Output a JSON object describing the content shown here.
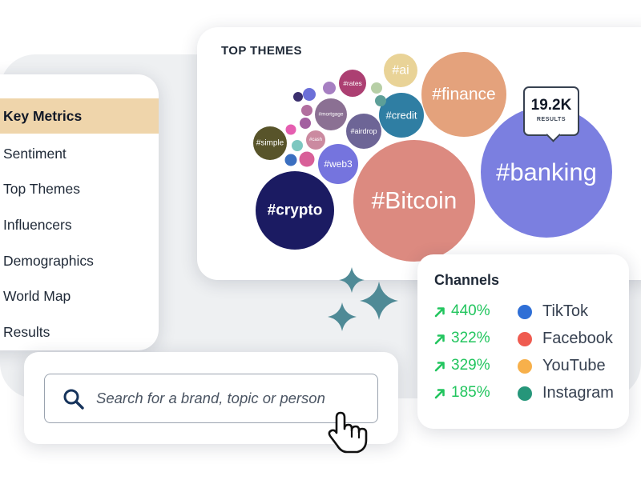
{
  "sidebar": {
    "items": [
      {
        "label": "Key Metrics",
        "active": true
      },
      {
        "label": "Sentiment",
        "active": false
      },
      {
        "label": "Top Themes",
        "active": false
      },
      {
        "label": "Influencers",
        "active": false
      },
      {
        "label": "Demographics",
        "active": false
      },
      {
        "label": "World Map",
        "active": false
      },
      {
        "label": "Results",
        "active": false
      }
    ]
  },
  "themes": {
    "title": "TOP THEMES",
    "bubbles": [
      {
        "label": "#banking",
        "color": "#7b7fe0"
      },
      {
        "label": "#Bitcoin",
        "color": "#dc8a80"
      },
      {
        "label": "#crypto",
        "color": "#1b1b62"
      },
      {
        "label": "#finance",
        "color": "#e4a27c"
      },
      {
        "label": "#credit",
        "color": "#2f7ea3"
      },
      {
        "label": "#ai",
        "color": "#e9d397"
      },
      {
        "label": "#web3",
        "color": "#7574de"
      },
      {
        "label": "#airdrop",
        "color": "#6d6596"
      },
      {
        "label": "#rates",
        "color": "#ac3f72"
      },
      {
        "label": "#mortgage",
        "color": "#8b7093"
      },
      {
        "label": "#simple",
        "color": "#58542a"
      },
      {
        "label": "#cash",
        "color": "#cb8aa0"
      },
      {
        "label": "",
        "color": "#6b6fd8"
      },
      {
        "label": "",
        "color": "#a67fc2"
      },
      {
        "label": "",
        "color": "#b26f9f"
      },
      {
        "label": "",
        "color": "#3b2f6e"
      },
      {
        "label": "",
        "color": "#a35fa0"
      },
      {
        "label": "",
        "color": "#e55db0"
      },
      {
        "label": "",
        "color": "#7dc7c0"
      },
      {
        "label": "",
        "color": "#3b6fc0"
      },
      {
        "label": "",
        "color": "#d85f98"
      },
      {
        "label": "",
        "color": "#5d9f98"
      },
      {
        "label": "",
        "color": "#b7cfa6"
      },
      {
        "label": "",
        "color": "#3f3c78"
      }
    ]
  },
  "callout": {
    "value": "19.2K",
    "label": "RESULTS"
  },
  "channels": {
    "title": "Channels",
    "items": [
      {
        "change": "440%",
        "name": "TikTok",
        "color": "#2f6fd6"
      },
      {
        "change": "322%",
        "name": "Facebook",
        "color": "#ef5b50"
      },
      {
        "change": "329%",
        "name": "YouTube",
        "color": "#f7b04b"
      },
      {
        "change": "185%",
        "name": "Instagram",
        "color": "#26967a"
      }
    ],
    "trend_color": "#22c55e"
  },
  "search": {
    "placeholder": "Search for a brand, topic or person",
    "value": ""
  }
}
